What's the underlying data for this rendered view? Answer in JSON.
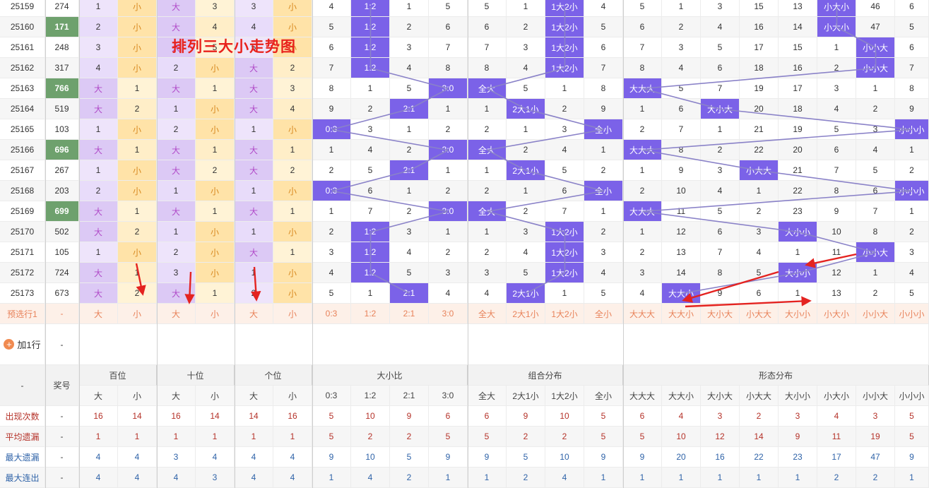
{
  "chart_title": "排列三大小走势图",
  "columns": [
    "大",
    "小",
    "大",
    "小",
    "大",
    "小",
    "0:3",
    "1:2",
    "2:1",
    "3:0",
    "全大",
    "2大1小",
    "1大2小",
    "全小",
    "大大大",
    "大大小",
    "大小大",
    "小大大",
    "大小小",
    "小大小",
    "小小大",
    "小小小"
  ],
  "rows": [
    {
      "issue": "25159",
      "num": "274",
      "c": [
        "1",
        "小",
        "大",
        "3",
        "3",
        "小",
        "4",
        "1:2",
        "1",
        "5",
        "5",
        "1",
        "1大2小",
        "4",
        "5",
        "1",
        "3",
        "15",
        "13",
        "小大小",
        "46",
        "6"
      ]
    },
    {
      "issue": "25160",
      "num": "171",
      "c": [
        "2",
        "小",
        "大",
        "4",
        "4",
        "小",
        "5",
        "1:2",
        "2",
        "6",
        "6",
        "2",
        "1大2小",
        "5",
        "6",
        "2",
        "4",
        "16",
        "14",
        "小大小",
        "47",
        "5"
      ]
    },
    {
      "issue": "25161",
      "num": "248",
      "c": [
        "3",
        "小",
        "大",
        "5",
        "5",
        "小",
        "6",
        "1:2",
        "3",
        "7",
        "7",
        "3",
        "1大2小",
        "6",
        "7",
        "3",
        "5",
        "17",
        "15",
        "1",
        "小小大",
        "6"
      ]
    },
    {
      "issue": "25162",
      "num": "317",
      "c": [
        "4",
        "小",
        "2",
        "小",
        "大",
        "2",
        "7",
        "1:2",
        "4",
        "8",
        "8",
        "4",
        "1大2小",
        "7",
        "8",
        "4",
        "6",
        "18",
        "16",
        "2",
        "小小大",
        "7"
      ]
    },
    {
      "issue": "25163",
      "num": "766",
      "c": [
        "大",
        "1",
        "大",
        "1",
        "大",
        "3",
        "8",
        "1",
        "5",
        "3:0",
        "全大",
        "5",
        "1",
        "8",
        "大大大",
        "5",
        "7",
        "19",
        "17",
        "3",
        "1",
        "8"
      ]
    },
    {
      "issue": "25164",
      "num": "519",
      "c": [
        "大",
        "2",
        "1",
        "小",
        "大",
        "4",
        "9",
        "2",
        "2:1",
        "1",
        "1",
        "2大1小",
        "2",
        "9",
        "1",
        "6",
        "大小大",
        "20",
        "18",
        "4",
        "2",
        "9"
      ]
    },
    {
      "issue": "25165",
      "num": "103",
      "c": [
        "1",
        "小",
        "2",
        "小",
        "1",
        "小",
        "0:3",
        "3",
        "1",
        "2",
        "2",
        "1",
        "3",
        "全小",
        "2",
        "7",
        "1",
        "21",
        "19",
        "5",
        "3",
        "小小小"
      ]
    },
    {
      "issue": "25166",
      "num": "696",
      "c": [
        "大",
        "1",
        "大",
        "1",
        "大",
        "1",
        "1",
        "4",
        "2",
        "3:0",
        "全大",
        "2",
        "4",
        "1",
        "大大大",
        "8",
        "2",
        "22",
        "20",
        "6",
        "4",
        "1"
      ]
    },
    {
      "issue": "25167",
      "num": "267",
      "c": [
        "1",
        "小",
        "大",
        "2",
        "大",
        "2",
        "2",
        "5",
        "2:1",
        "1",
        "1",
        "2大1小",
        "5",
        "2",
        "1",
        "9",
        "3",
        "小大大",
        "21",
        "7",
        "5",
        "2"
      ]
    },
    {
      "issue": "25168",
      "num": "203",
      "c": [
        "2",
        "小",
        "1",
        "小",
        "1",
        "小",
        "0:3",
        "6",
        "1",
        "2",
        "2",
        "1",
        "6",
        "全小",
        "2",
        "10",
        "4",
        "1",
        "22",
        "8",
        "6",
        "小小小"
      ]
    },
    {
      "issue": "25169",
      "num": "699",
      "c": [
        "大",
        "1",
        "大",
        "1",
        "大",
        "1",
        "1",
        "7",
        "2",
        "3:0",
        "全大",
        "2",
        "7",
        "1",
        "大大大",
        "11",
        "5",
        "2",
        "23",
        "9",
        "7",
        "1"
      ]
    },
    {
      "issue": "25170",
      "num": "502",
      "c": [
        "大",
        "2",
        "1",
        "小",
        "1",
        "小",
        "2",
        "1:2",
        "3",
        "1",
        "1",
        "3",
        "1大2小",
        "2",
        "1",
        "12",
        "6",
        "3",
        "大小小",
        "10",
        "8",
        "2"
      ]
    },
    {
      "issue": "25171",
      "num": "105",
      "c": [
        "1",
        "小",
        "2",
        "小",
        "大",
        "1",
        "3",
        "1:2",
        "4",
        "2",
        "2",
        "4",
        "1大2小",
        "3",
        "2",
        "13",
        "7",
        "4",
        "1",
        "11",
        "小小大",
        "3"
      ]
    },
    {
      "issue": "25172",
      "num": "724",
      "c": [
        "大",
        "1",
        "3",
        "小",
        "1",
        "小",
        "4",
        "1:2",
        "5",
        "3",
        "3",
        "5",
        "1大2小",
        "4",
        "3",
        "14",
        "8",
        "5",
        "大小小",
        "12",
        "1",
        "4"
      ]
    },
    {
      "issue": "25173",
      "num": "673",
      "c": [
        "大",
        "2",
        "大",
        "1",
        "2",
        "小",
        "5",
        "1",
        "2:1",
        "4",
        "4",
        "2大1小",
        "1",
        "5",
        "4",
        "大大小",
        "9",
        "6",
        "1",
        "13",
        "2",
        "5"
      ]
    }
  ],
  "preselect": {
    "label": "预选行1",
    "num": "-",
    "c": [
      "大",
      "小",
      "大",
      "小",
      "大",
      "小",
      "0:3",
      "1:2",
      "2:1",
      "3:0",
      "全大",
      "2大1小",
      "1大2小",
      "全小",
      "大大大",
      "大大小",
      "大小大",
      "小大大",
      "大小小",
      "小大小",
      "小小大",
      "小小小"
    ]
  },
  "add_row": {
    "label": "加1行",
    "plus": "+",
    "num": "-"
  },
  "header": {
    "dash": "-",
    "num_label": "奖号",
    "groups": [
      "百位",
      "十位",
      "个位",
      "大小比",
      "组合分布",
      "形态分布"
    ]
  },
  "stats": [
    {
      "label": "出现次数",
      "num": "-",
      "v": [
        "16",
        "14",
        "16",
        "14",
        "14",
        "16",
        "5",
        "10",
        "9",
        "6",
        "6",
        "9",
        "10",
        "5",
        "6",
        "4",
        "3",
        "2",
        "3",
        "4",
        "3",
        "5"
      ]
    },
    {
      "label": "平均遗漏",
      "num": "-",
      "v": [
        "1",
        "1",
        "1",
        "1",
        "1",
        "1",
        "5",
        "2",
        "2",
        "5",
        "5",
        "2",
        "2",
        "5",
        "5",
        "10",
        "12",
        "14",
        "9",
        "11",
        "19",
        "5"
      ]
    },
    {
      "label": "最大遗漏",
      "num": "-",
      "v": [
        "4",
        "4",
        "3",
        "4",
        "4",
        "4",
        "9",
        "10",
        "5",
        "9",
        "9",
        "5",
        "10",
        "9",
        "9",
        "20",
        "16",
        "22",
        "23",
        "17",
        "47",
        "9"
      ]
    },
    {
      "label": "最大连出",
      "num": "-",
      "v": [
        "4",
        "4",
        "4",
        "3",
        "4",
        "4",
        "1",
        "4",
        "2",
        "1",
        "1",
        "2",
        "4",
        "1",
        "1",
        "1",
        "1",
        "1",
        "1",
        "2",
        "2",
        "1"
      ]
    }
  ],
  "colors": {
    "big_bg": "#dcc9f5",
    "small_bg": "#ffe3a8",
    "hit_bg": "#7b62e8",
    "hit_text": "#ffffff",
    "num_hl_bg": "#6ea16d",
    "line": "#8a82c8",
    "arrow": "#e42320",
    "red": "#b53229",
    "blue": "#2f63a8",
    "stripe": "#f6f6f6",
    "preselect_bg": "#fdf0e8",
    "preselect_text": "#e8825a",
    "header_bg": "#f2f2f2"
  }
}
